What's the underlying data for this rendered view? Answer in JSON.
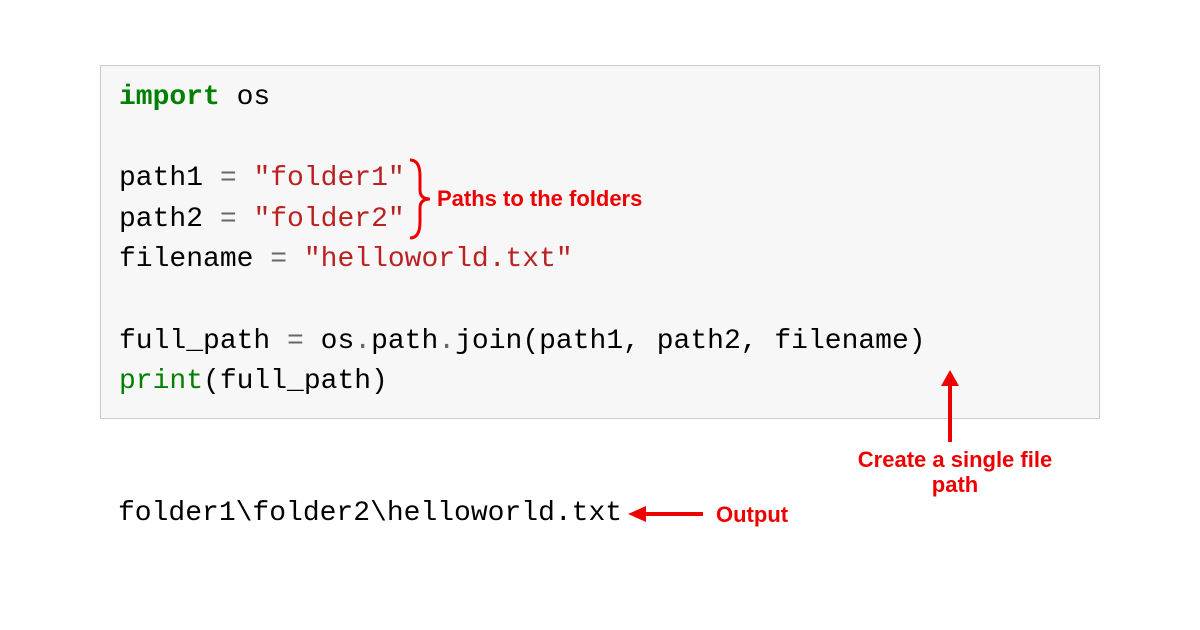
{
  "code": {
    "line1_kw": "import",
    "line1_mod": " os",
    "blank": "",
    "line3_var": "path1 ",
    "line3_op": "=",
    "line3_sp": " ",
    "line3_str": "\"folder1\"",
    "line4_var": "path2 ",
    "line4_op": "=",
    "line4_sp": " ",
    "line4_str": "\"folder2\"",
    "line5_var": "filename ",
    "line5_op": "=",
    "line5_sp": " ",
    "line5_str": "\"helloworld.txt\"",
    "line7_a": "full_path ",
    "line7_op": "=",
    "line7_b": " os",
    "line7_op2": ".",
    "line7_c": "path",
    "line7_op3": ".",
    "line7_d": "join(path1, path2, filename)",
    "line8_fn": "print",
    "line8_args": "(full_path)"
  },
  "output": "folder1\\folder2\\helloworld.txt",
  "annotations": {
    "paths_label": "Paths to the folders",
    "create_label_l1": "Create a single file",
    "create_label_l2": "path",
    "output_label": "Output"
  },
  "colors": {
    "annotation": "#ed0000",
    "code_bg": "#f7f7f7",
    "string": "#ba2121",
    "keyword": "#008000"
  }
}
